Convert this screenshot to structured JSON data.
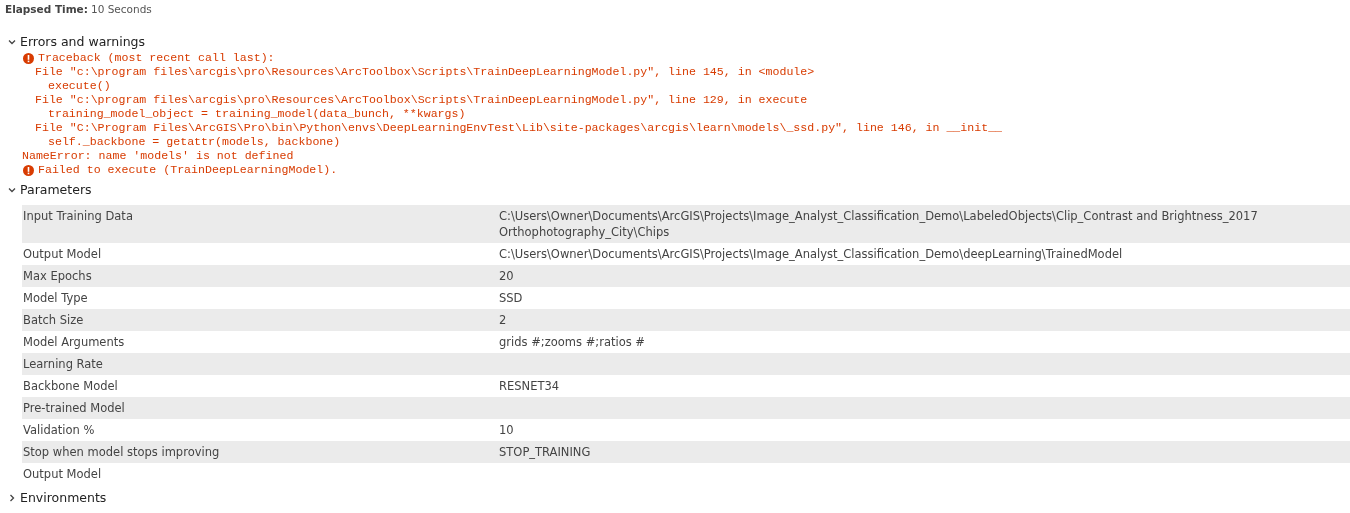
{
  "elapsed": {
    "label": "Elapsed Time:",
    "value": "10 Seconds"
  },
  "errors": {
    "title": "Errors and warnings",
    "expanded": true,
    "lines": [
      {
        "kind": "error",
        "text": "Traceback (most recent call last):"
      },
      {
        "kind": "file",
        "text": "File \"c:\\program files\\arcgis\\pro\\Resources\\ArcToolbox\\Scripts\\TrainDeepLearningModel.py\", line 145, in <module>"
      },
      {
        "kind": "code",
        "text": "execute()"
      },
      {
        "kind": "file",
        "text": "File \"c:\\program files\\arcgis\\pro\\Resources\\ArcToolbox\\Scripts\\TrainDeepLearningModel.py\", line 129, in execute"
      },
      {
        "kind": "code",
        "text": "training_model_object = training_model(data_bunch, **kwargs)"
      },
      {
        "kind": "file",
        "text": "File \"C:\\Program Files\\ArcGIS\\Pro\\bin\\Python\\envs\\DeepLearningEnvTest\\Lib\\site-packages\\arcgis\\learn\\models\\_ssd.py\", line 146, in __init__"
      },
      {
        "kind": "code",
        "text": "self._backbone = getattr(models, backbone)"
      },
      {
        "kind": "plain",
        "text": "NameError: name 'models' is not defined"
      },
      {
        "kind": "error",
        "text": "Failed to execute (TrainDeepLearningModel)."
      }
    ]
  },
  "parameters": {
    "title": "Parameters",
    "expanded": true,
    "rows": [
      {
        "name": "Input Training Data",
        "value": "C:\\Users\\Owner\\Documents\\ArcGIS\\Projects\\Image_Analyst_Classification_Demo\\LabeledObjects\\Clip_Contrast and Brightness_2017 Orthophotography_City\\Chips"
      },
      {
        "name": "Output Model",
        "value": "C:\\Users\\Owner\\Documents\\ArcGIS\\Projects\\Image_Analyst_Classification_Demo\\deepLearning\\TrainedModel"
      },
      {
        "name": "Max Epochs",
        "value": "20"
      },
      {
        "name": "Model Type",
        "value": "SSD"
      },
      {
        "name": "Batch Size",
        "value": "2"
      },
      {
        "name": "Model Arguments",
        "value": "grids #;zooms #;ratios #"
      },
      {
        "name": "Learning Rate"
      },
      {
        "name": "Backbone Model",
        "value": "RESNET34"
      },
      {
        "name": "Pre-trained Model"
      },
      {
        "name": "Validation %",
        "value": "10"
      },
      {
        "name": "Stop when model stops improving",
        "value": "STOP_TRAINING"
      },
      {
        "name": "Output Model"
      }
    ]
  },
  "environments": {
    "title": "Environments",
    "expanded": false
  }
}
